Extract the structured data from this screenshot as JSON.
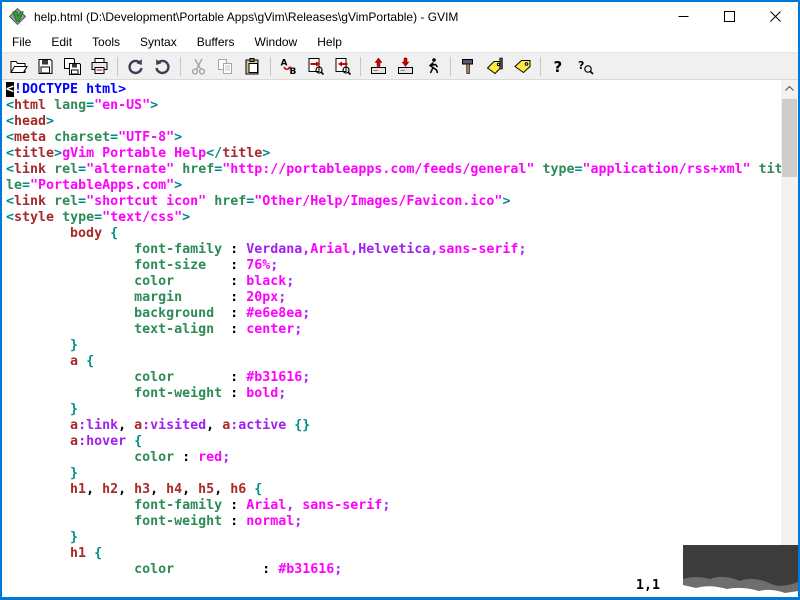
{
  "window": {
    "title": "help.html (D:\\Development\\Portable Apps\\gVim\\Releases\\gVimPortable) - GVIM",
    "app_icon": "vim-logo-icon",
    "controls": [
      {
        "icon": "minimize"
      },
      {
        "icon": "maximize"
      },
      {
        "icon": "close"
      }
    ],
    "border_color": "#0078d7"
  },
  "menu": [
    "File",
    "Edit",
    "Tools",
    "Syntax",
    "Buffers",
    "Window",
    "Help"
  ],
  "toolbar": [
    {
      "icon": "open"
    },
    {
      "icon": "save"
    },
    {
      "icon": "saveall"
    },
    {
      "icon": "print"
    },
    {
      "sep": true
    },
    {
      "icon": "undo"
    },
    {
      "icon": "redo"
    },
    {
      "sep": true
    },
    {
      "icon": "cut",
      "disabled": true
    },
    {
      "icon": "copy",
      "disabled": true
    },
    {
      "icon": "paste"
    },
    {
      "sep": true
    },
    {
      "icon": "replace"
    },
    {
      "icon": "findnext"
    },
    {
      "icon": "findprev"
    },
    {
      "sep": true
    },
    {
      "icon": "loadsesn"
    },
    {
      "icon": "savesesn"
    },
    {
      "icon": "runscript"
    },
    {
      "sep": true
    },
    {
      "icon": "make"
    },
    {
      "icon": "runctags"
    },
    {
      "icon": "tagjump"
    },
    {
      "sep": true
    },
    {
      "icon": "help"
    },
    {
      "icon": "findhelp"
    }
  ],
  "editor": {
    "ruler": "1,1",
    "syntax_colors": {
      "comment": "#0000ff",
      "tag_bracket": "#008b8b",
      "tag_name": "#a52a2a",
      "attribute": "#2e8b57",
      "string": "#ff00ff",
      "preproc": "#a020f0",
      "html_title": "#ff00ff",
      "plain": "#000000"
    },
    "lines": [
      [
        {
          "c": "cursor",
          "t": "<"
        },
        {
          "c": "comment",
          "t": "!DOCTYPE html>"
        }
      ],
      [
        {
          "c": "tag",
          "t": "<"
        },
        {
          "c": "tagname",
          "t": "html"
        },
        {
          "c": "text",
          "t": " "
        },
        {
          "c": "arg",
          "t": "lang"
        },
        {
          "c": "tag",
          "t": "="
        },
        {
          "c": "str",
          "t": "\"en-US\""
        },
        {
          "c": "tag",
          "t": ">"
        }
      ],
      [
        {
          "c": "tag",
          "t": "<"
        },
        {
          "c": "tagname",
          "t": "head"
        },
        {
          "c": "tag",
          "t": ">"
        }
      ],
      [
        {
          "c": "tag",
          "t": "<"
        },
        {
          "c": "tagname",
          "t": "meta"
        },
        {
          "c": "text",
          "t": " "
        },
        {
          "c": "arg",
          "t": "charset"
        },
        {
          "c": "tag",
          "t": "="
        },
        {
          "c": "str",
          "t": "\"UTF-8\""
        },
        {
          "c": "tag",
          "t": ">"
        }
      ],
      [
        {
          "c": "tag",
          "t": "<"
        },
        {
          "c": "tagname",
          "t": "title"
        },
        {
          "c": "tag",
          "t": ">"
        },
        {
          "c": "title",
          "t": "gVim Portable Help"
        },
        {
          "c": "tag",
          "t": "</"
        },
        {
          "c": "tagname",
          "t": "title"
        },
        {
          "c": "tag",
          "t": ">"
        }
      ],
      [
        {
          "c": "tag",
          "t": "<"
        },
        {
          "c": "tagname",
          "t": "link"
        },
        {
          "c": "text",
          "t": " "
        },
        {
          "c": "arg",
          "t": "rel"
        },
        {
          "c": "tag",
          "t": "="
        },
        {
          "c": "str",
          "t": "\"alternate\""
        },
        {
          "c": "text",
          "t": " "
        },
        {
          "c": "arg",
          "t": "href"
        },
        {
          "c": "tag",
          "t": "="
        },
        {
          "c": "str",
          "t": "\"http://portableapps.com/feeds/general\""
        },
        {
          "c": "text",
          "t": " "
        },
        {
          "c": "arg",
          "t": "type"
        },
        {
          "c": "tag",
          "t": "="
        },
        {
          "c": "str",
          "t": "\"application/rss+xml\""
        },
        {
          "c": "text",
          "t": " "
        },
        {
          "c": "arg",
          "t": "tit"
        }
      ],
      [
        {
          "c": "arg",
          "t": "le"
        },
        {
          "c": "tag",
          "t": "="
        },
        {
          "c": "str",
          "t": "\"PortableApps.com\""
        },
        {
          "c": "tag",
          "t": ">"
        }
      ],
      [
        {
          "c": "tag",
          "t": "<"
        },
        {
          "c": "tagname",
          "t": "link"
        },
        {
          "c": "text",
          "t": " "
        },
        {
          "c": "arg",
          "t": "rel"
        },
        {
          "c": "tag",
          "t": "="
        },
        {
          "c": "str",
          "t": "\"shortcut icon\""
        },
        {
          "c": "text",
          "t": " "
        },
        {
          "c": "arg",
          "t": "href"
        },
        {
          "c": "tag",
          "t": "="
        },
        {
          "c": "str",
          "t": "\"Other/Help/Images/Favicon.ico\""
        },
        {
          "c": "tag",
          "t": ">"
        }
      ],
      [
        {
          "c": "tag",
          "t": "<"
        },
        {
          "c": "tagname",
          "t": "style"
        },
        {
          "c": "text",
          "t": " "
        },
        {
          "c": "arg",
          "t": "type"
        },
        {
          "c": "tag",
          "t": "="
        },
        {
          "c": "str",
          "t": "\"text/css\""
        },
        {
          "c": "tag",
          "t": ">"
        }
      ],
      [
        {
          "c": "text",
          "t": "        "
        },
        {
          "c": "tagname",
          "t": "body"
        },
        {
          "c": "text",
          "t": " "
        },
        {
          "c": "tag",
          "t": "{"
        }
      ],
      [
        {
          "c": "text",
          "t": "                "
        },
        {
          "c": "arg",
          "t": "font-family"
        },
        {
          "c": "text",
          "t": " : "
        },
        {
          "c": "pre",
          "t": "Verdana"
        },
        {
          "c": "pre",
          "t": ","
        },
        {
          "c": "str",
          "t": "Arial"
        },
        {
          "c": "pre",
          "t": ","
        },
        {
          "c": "pre",
          "t": "Helvetica"
        },
        {
          "c": "pre",
          "t": ","
        },
        {
          "c": "str",
          "t": "sans-serif"
        },
        {
          "c": "pre",
          "t": ";"
        }
      ],
      [
        {
          "c": "text",
          "t": "                "
        },
        {
          "c": "arg",
          "t": "font-size"
        },
        {
          "c": "text",
          "t": "   : "
        },
        {
          "c": "str",
          "t": "76%"
        },
        {
          "c": "pre",
          "t": ";"
        }
      ],
      [
        {
          "c": "text",
          "t": "                "
        },
        {
          "c": "arg",
          "t": "color"
        },
        {
          "c": "text",
          "t": "       : "
        },
        {
          "c": "str",
          "t": "black"
        },
        {
          "c": "pre",
          "t": ";"
        }
      ],
      [
        {
          "c": "text",
          "t": "                "
        },
        {
          "c": "arg",
          "t": "margin"
        },
        {
          "c": "text",
          "t": "      : "
        },
        {
          "c": "str",
          "t": "20px"
        },
        {
          "c": "pre",
          "t": ";"
        }
      ],
      [
        {
          "c": "text",
          "t": "                "
        },
        {
          "c": "arg",
          "t": "background"
        },
        {
          "c": "text",
          "t": "  : "
        },
        {
          "c": "str",
          "t": "#e6e8ea"
        },
        {
          "c": "pre",
          "t": ";"
        }
      ],
      [
        {
          "c": "text",
          "t": "                "
        },
        {
          "c": "arg",
          "t": "text-align"
        },
        {
          "c": "text",
          "t": "  : "
        },
        {
          "c": "str",
          "t": "center"
        },
        {
          "c": "pre",
          "t": ";"
        }
      ],
      [
        {
          "c": "text",
          "t": "        "
        },
        {
          "c": "tag",
          "t": "}"
        }
      ],
      [
        {
          "c": "text",
          "t": "        "
        },
        {
          "c": "tagname",
          "t": "a"
        },
        {
          "c": "text",
          "t": " "
        },
        {
          "c": "tag",
          "t": "{"
        }
      ],
      [
        {
          "c": "text",
          "t": "                "
        },
        {
          "c": "arg",
          "t": "color"
        },
        {
          "c": "text",
          "t": "       : "
        },
        {
          "c": "str",
          "t": "#b31616"
        },
        {
          "c": "pre",
          "t": ";"
        }
      ],
      [
        {
          "c": "text",
          "t": "                "
        },
        {
          "c": "arg",
          "t": "font-weight"
        },
        {
          "c": "text",
          "t": " : "
        },
        {
          "c": "str",
          "t": "bold"
        },
        {
          "c": "pre",
          "t": ";"
        }
      ],
      [
        {
          "c": "text",
          "t": "        "
        },
        {
          "c": "tag",
          "t": "}"
        }
      ],
      [
        {
          "c": "text",
          "t": "        "
        },
        {
          "c": "tagname",
          "t": "a"
        },
        {
          "c": "pre",
          "t": ":link"
        },
        {
          "c": "text",
          "t": ", "
        },
        {
          "c": "tagname",
          "t": "a"
        },
        {
          "c": "pre",
          "t": ":visited"
        },
        {
          "c": "text",
          "t": ", "
        },
        {
          "c": "tagname",
          "t": "a"
        },
        {
          "c": "pre",
          "t": ":active"
        },
        {
          "c": "text",
          "t": " "
        },
        {
          "c": "tag",
          "t": "{}"
        }
      ],
      [
        {
          "c": "text",
          "t": "        "
        },
        {
          "c": "tagname",
          "t": "a"
        },
        {
          "c": "pre",
          "t": ":hover"
        },
        {
          "c": "text",
          "t": " "
        },
        {
          "c": "tag",
          "t": "{"
        }
      ],
      [
        {
          "c": "text",
          "t": "                "
        },
        {
          "c": "arg",
          "t": "color"
        },
        {
          "c": "text",
          "t": " : "
        },
        {
          "c": "str",
          "t": "red"
        },
        {
          "c": "pre",
          "t": ";"
        }
      ],
      [
        {
          "c": "text",
          "t": "        "
        },
        {
          "c": "tag",
          "t": "}"
        }
      ],
      [
        {
          "c": "text",
          "t": "        "
        },
        {
          "c": "tagname",
          "t": "h1"
        },
        {
          "c": "text",
          "t": ", "
        },
        {
          "c": "tagname",
          "t": "h2"
        },
        {
          "c": "text",
          "t": ", "
        },
        {
          "c": "tagname",
          "t": "h3"
        },
        {
          "c": "text",
          "t": ", "
        },
        {
          "c": "tagname",
          "t": "h4"
        },
        {
          "c": "text",
          "t": ", "
        },
        {
          "c": "tagname",
          "t": "h5"
        },
        {
          "c": "text",
          "t": ", "
        },
        {
          "c": "tagname",
          "t": "h6"
        },
        {
          "c": "text",
          "t": " "
        },
        {
          "c": "tag",
          "t": "{"
        }
      ],
      [
        {
          "c": "text",
          "t": "                "
        },
        {
          "c": "arg",
          "t": "font-family"
        },
        {
          "c": "text",
          "t": " : "
        },
        {
          "c": "str",
          "t": "Arial"
        },
        {
          "c": "pre",
          "t": ","
        },
        {
          "c": "text",
          "t": " "
        },
        {
          "c": "str",
          "t": "sans-serif"
        },
        {
          "c": "pre",
          "t": ";"
        }
      ],
      [
        {
          "c": "text",
          "t": "                "
        },
        {
          "c": "arg",
          "t": "font-weight"
        },
        {
          "c": "text",
          "t": " : "
        },
        {
          "c": "str",
          "t": "normal"
        },
        {
          "c": "pre",
          "t": ";"
        }
      ],
      [
        {
          "c": "text",
          "t": "        "
        },
        {
          "c": "tag",
          "t": "}"
        }
      ],
      [
        {
          "c": "text",
          "t": "        "
        },
        {
          "c": "tagname",
          "t": "h1"
        },
        {
          "c": "text",
          "t": " "
        },
        {
          "c": "tag",
          "t": "{"
        }
      ],
      [
        {
          "c": "text",
          "t": "                "
        },
        {
          "c": "arg",
          "t": "color"
        },
        {
          "c": "text",
          "t": "           : "
        },
        {
          "c": "str",
          "t": "#b31616"
        },
        {
          "c": "pre",
          "t": ";"
        }
      ]
    ]
  }
}
